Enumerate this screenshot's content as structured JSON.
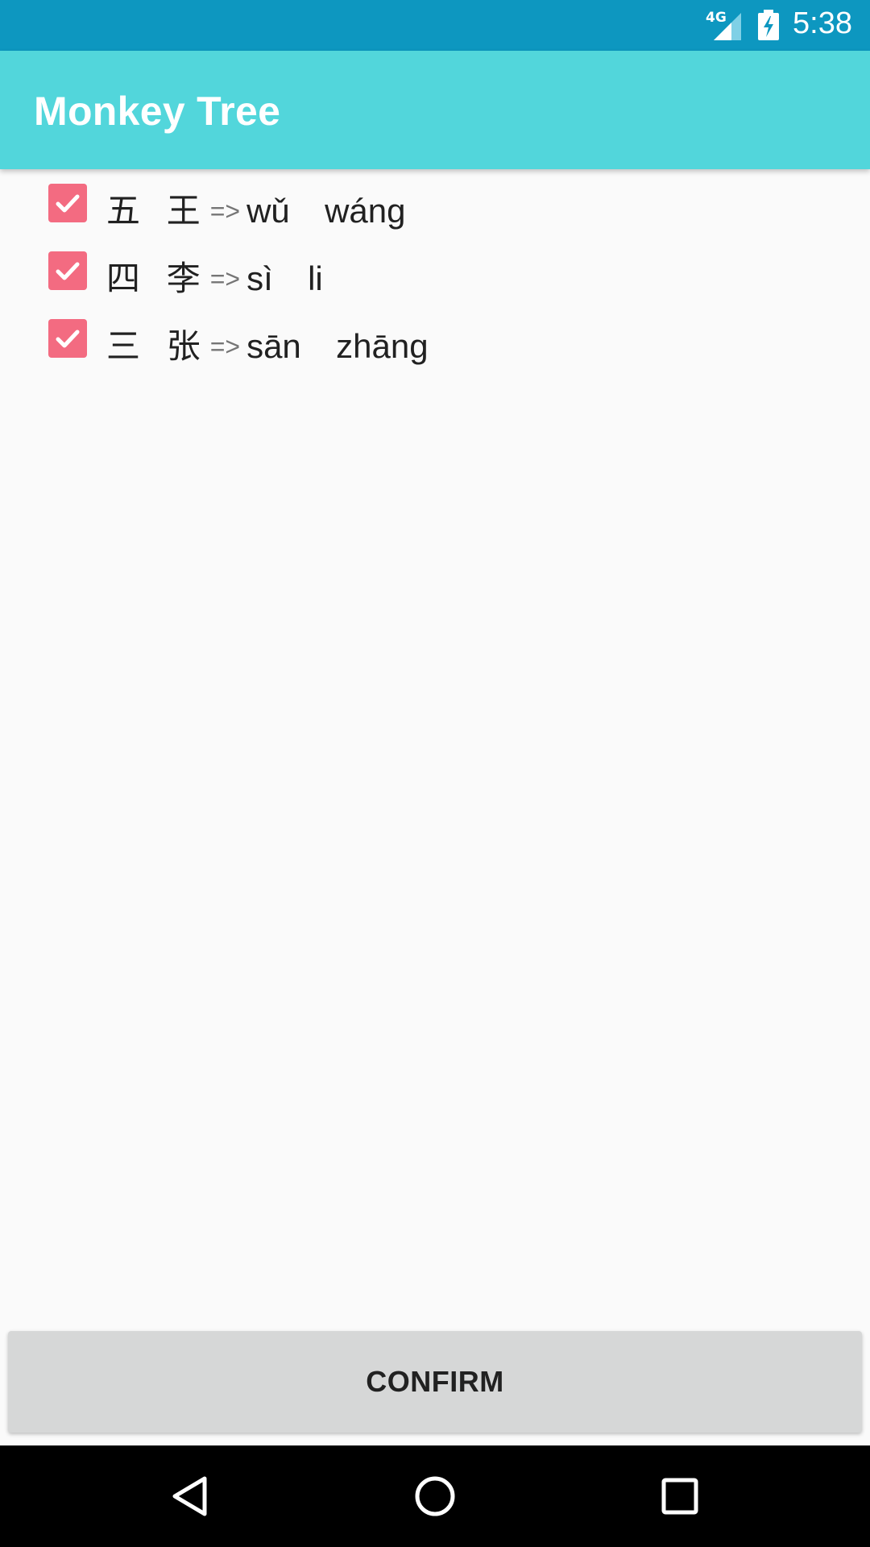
{
  "status_bar": {
    "network_label": "4G",
    "time": "5:38",
    "icons": [
      "signal-icon",
      "battery-charging-icon"
    ]
  },
  "app_bar": {
    "title": "Monkey Tree",
    "color": "#52d6db"
  },
  "items": [
    {
      "hanzi": "五  王",
      "arrow": "=>",
      "pinyin": "wǔ  wáng",
      "checked": true
    },
    {
      "hanzi": "四  李",
      "arrow": "=>",
      "pinyin": "sì  li",
      "checked": true
    },
    {
      "hanzi": "三  张",
      "arrow": "=>",
      "pinyin": "sān  zhāng",
      "checked": true
    }
  ],
  "confirm_button": {
    "label": "CONFIRM"
  },
  "nav_bar": {
    "icons": [
      "back-icon",
      "home-icon",
      "recents-icon"
    ]
  },
  "colors": {
    "status_bar": "#0d97c0",
    "checkbox": "#f36b81",
    "button": "#d6d7d7"
  }
}
